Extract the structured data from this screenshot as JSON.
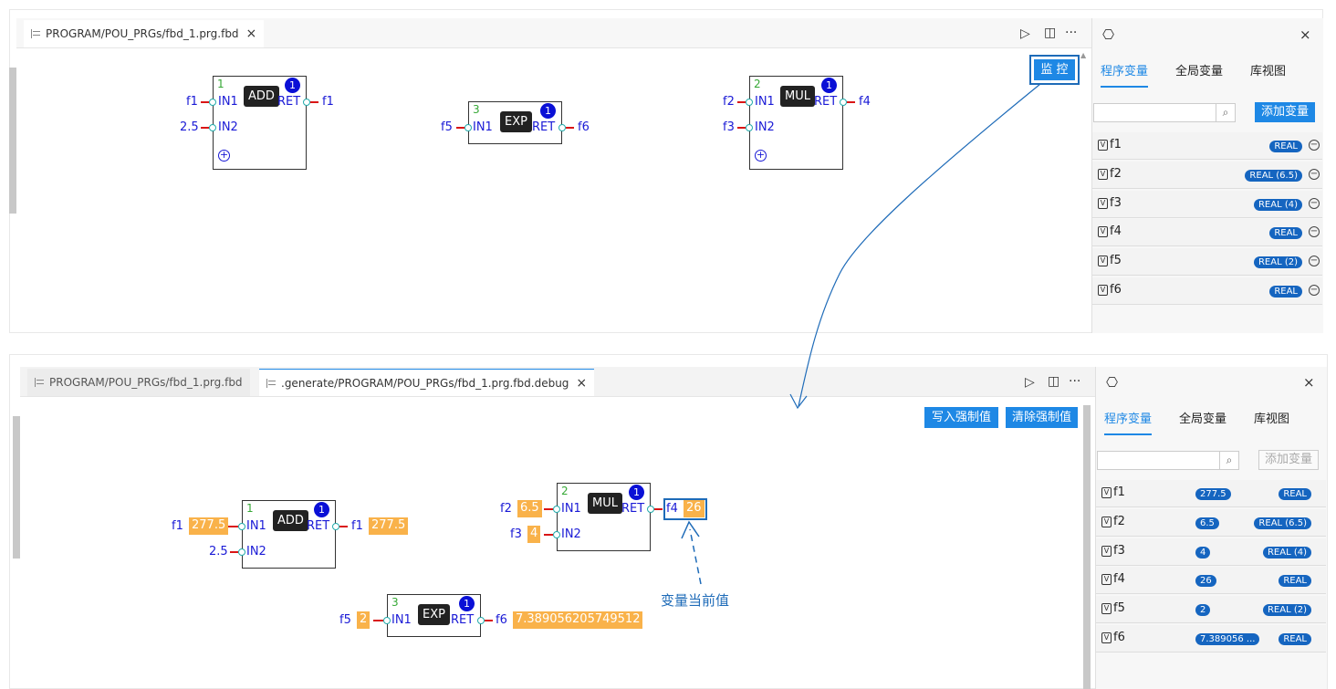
{
  "top": {
    "tabs": [
      {
        "label": "PROGRAM/POU_PRGs/fbd_1.prg.fbd",
        "close": "×"
      }
    ],
    "toolbar": {
      "run": "▷",
      "split": "◫",
      "more": "···"
    },
    "monitor_button": "监 控",
    "blocks": [
      {
        "num": "1",
        "name": "ADD",
        "badge": "1",
        "in1": "IN1",
        "in2": "IN2",
        "ret": "RET",
        "in1_var": "f1",
        "in2_var": "2.5",
        "out_var": "f1"
      },
      {
        "num": "3",
        "name": "EXP",
        "badge": "1",
        "in1": "IN1",
        "ret": "RET",
        "in1_var": "f5",
        "out_var": "f6"
      },
      {
        "num": "2",
        "name": "MUL",
        "badge": "1",
        "in1": "IN1",
        "in2": "IN2",
        "ret": "RET",
        "in1_var": "f2",
        "in2_var": "f3",
        "out_var": "f4"
      }
    ],
    "side": {
      "tabs": [
        "程序变量",
        "全局变量",
        "库视图"
      ],
      "add_button": "添加变量",
      "vars": [
        {
          "name": "f1",
          "type": "REAL"
        },
        {
          "name": "f2",
          "type": "REAL (6.5)"
        },
        {
          "name": "f3",
          "type": "REAL (4)"
        },
        {
          "name": "f4",
          "type": "REAL"
        },
        {
          "name": "f5",
          "type": "REAL (2)"
        },
        {
          "name": "f6",
          "type": "REAL"
        }
      ]
    }
  },
  "bottom": {
    "tabs": [
      {
        "label": "PROGRAM/POU_PRGs/fbd_1.prg.fbd"
      },
      {
        "label": ".generate/PROGRAM/POU_PRGs/fbd_1.prg.fbd.debug",
        "close": "×"
      }
    ],
    "write_force": "写入强制值",
    "clear_force": "清除强制值",
    "blocks": [
      {
        "num": "1",
        "name": "ADD",
        "badge": "1",
        "in1": "IN1",
        "in2": "IN2",
        "ret": "RET",
        "in1_var": "f1",
        "in1_val": "277.5",
        "in2_var": "2.5",
        "out_var": "f1",
        "out_val": "277.5"
      },
      {
        "num": "2",
        "name": "MUL",
        "badge": "1",
        "in1": "IN1",
        "in2": "IN2",
        "ret": "RET",
        "in1_var": "f2",
        "in1_val": "6.5",
        "in2_var": "f3",
        "in2_val": "4",
        "out_var": "f4",
        "out_val": "26"
      },
      {
        "num": "3",
        "name": "EXP",
        "badge": "1",
        "in1": "IN1",
        "ret": "RET",
        "in1_var": "f5",
        "in1_val": "2",
        "out_var": "f6",
        "out_val": "7.389056205749512"
      }
    ],
    "annotation": "变量当前值",
    "side": {
      "tabs": [
        "程序变量",
        "全局变量",
        "库视图"
      ],
      "add_button": "添加变量",
      "vars": [
        {
          "name": "f1",
          "value": "277.5",
          "type": "REAL"
        },
        {
          "name": "f2",
          "value": "6.5",
          "type": "REAL (6.5)"
        },
        {
          "name": "f3",
          "value": "4",
          "type": "REAL (4)"
        },
        {
          "name": "f4",
          "value": "26",
          "type": "REAL"
        },
        {
          "name": "f5",
          "value": "2",
          "type": "REAL (2)"
        },
        {
          "name": "f6",
          "value": "7.389056 ...",
          "type": "REAL"
        }
      ]
    }
  },
  "colors": {
    "accent": "#1e88e5",
    "value_bg": "#f9b24a",
    "wire": "#d91515",
    "pin_text": "#1a1ad6",
    "badge": "#0a10d6"
  }
}
